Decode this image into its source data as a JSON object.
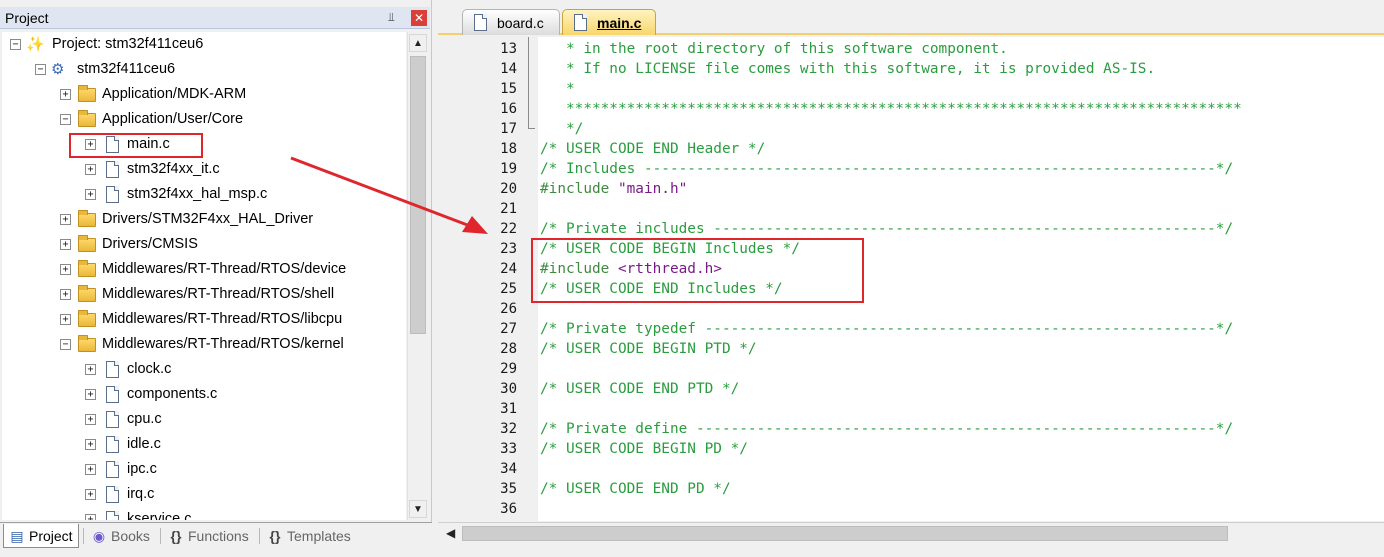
{
  "project_pane": {
    "title": "Project",
    "pin_glyph": "⫫",
    "close_glyph": "✕",
    "tree": [
      {
        "label": "Project: stm32f411ceu6",
        "kind": "project",
        "expander": "−",
        "indent": 0
      },
      {
        "label": "stm32f411ceu6",
        "kind": "target",
        "expander": "−",
        "indent": 1
      },
      {
        "label": "Application/MDK-ARM",
        "kind": "folder",
        "expander": "+",
        "indent": 2
      },
      {
        "label": "Application/User/Core",
        "kind": "folder-open",
        "expander": "−",
        "indent": 2
      },
      {
        "label": "main.c",
        "kind": "file",
        "expander": "+",
        "indent": 3
      },
      {
        "label": "stm32f4xx_it.c",
        "kind": "file",
        "expander": "+",
        "indent": 3
      },
      {
        "label": "stm32f4xx_hal_msp.c",
        "kind": "file",
        "expander": "+",
        "indent": 3
      },
      {
        "label": "Drivers/STM32F4xx_HAL_Driver",
        "kind": "folder",
        "expander": "+",
        "indent": 2
      },
      {
        "label": "Drivers/CMSIS",
        "kind": "folder",
        "expander": "+",
        "indent": 2
      },
      {
        "label": "Middlewares/RT-Thread/RTOS/device",
        "kind": "folder",
        "expander": "+",
        "indent": 2
      },
      {
        "label": "Middlewares/RT-Thread/RTOS/shell",
        "kind": "folder",
        "expander": "+",
        "indent": 2
      },
      {
        "label": "Middlewares/RT-Thread/RTOS/libcpu",
        "kind": "folder",
        "expander": "+",
        "indent": 2
      },
      {
        "label": "Middlewares/RT-Thread/RTOS/kernel",
        "kind": "folder-open",
        "expander": "−",
        "indent": 2
      },
      {
        "label": "clock.c",
        "kind": "file",
        "expander": "+",
        "indent": 3
      },
      {
        "label": "components.c",
        "kind": "file",
        "expander": "+",
        "indent": 3
      },
      {
        "label": "cpu.c",
        "kind": "file",
        "expander": "+",
        "indent": 3
      },
      {
        "label": "idle.c",
        "kind": "file",
        "expander": "+",
        "indent": 3
      },
      {
        "label": "ipc.c",
        "kind": "file",
        "expander": "+",
        "indent": 3
      },
      {
        "label": "irq.c",
        "kind": "file",
        "expander": "+",
        "indent": 3
      },
      {
        "label": "kservice.c",
        "kind": "file",
        "expander": "+",
        "indent": 3
      }
    ],
    "highlighted_item": "main.c",
    "bottom_tabs": [
      {
        "label": "Project",
        "icon": "▤",
        "active": true
      },
      {
        "label": "Books",
        "icon": "◉",
        "active": false
      },
      {
        "label": "Functions",
        "icon": "{}",
        "active": false
      },
      {
        "label": "Templates",
        "icon": "{}",
        "active": false
      }
    ]
  },
  "editor": {
    "tabs": [
      {
        "label": "board.c",
        "active": false
      },
      {
        "label": "main.c",
        "active": true
      }
    ],
    "lines": [
      {
        "n": "13",
        "text": "   * in the root directory of this software component.",
        "cls": "c-comment"
      },
      {
        "n": "14",
        "text": "   * If no LICENSE file comes with this software, it is provided AS-IS.",
        "cls": "c-comment"
      },
      {
        "n": "15",
        "text": "   *",
        "cls": "c-comment"
      },
      {
        "n": "16",
        "text": "   ******************************************************************************",
        "cls": "c-comment"
      },
      {
        "n": "17",
        "text": "   */",
        "cls": "c-comment"
      },
      {
        "n": "18",
        "text": "/* USER CODE END Header */",
        "cls": "c-comment"
      },
      {
        "n": "19",
        "text": "/* Includes ------------------------------------------------------------------*/",
        "cls": "c-comment"
      },
      {
        "n": "20",
        "pre": "#include ",
        "str": "\"main.h\"",
        "cls": "c-pre"
      },
      {
        "n": "21",
        "text": "",
        "cls": "c-comment"
      },
      {
        "n": "22",
        "text": "/* Private includes ----------------------------------------------------------*/",
        "cls": "c-comment"
      },
      {
        "n": "23",
        "text": "/* USER CODE BEGIN Includes */",
        "cls": "c-comment"
      },
      {
        "n": "24",
        "pre": "#include ",
        "str": "<rtthread.h>",
        "cls": "c-pre"
      },
      {
        "n": "25",
        "text": "/* USER CODE END Includes */",
        "cls": "c-comment"
      },
      {
        "n": "26",
        "text": "",
        "cls": "c-comment"
      },
      {
        "n": "27",
        "text": "/* Private typedef -----------------------------------------------------------*/",
        "cls": "c-comment"
      },
      {
        "n": "28",
        "text": "/* USER CODE BEGIN PTD */",
        "cls": "c-comment"
      },
      {
        "n": "29",
        "text": "",
        "cls": "c-comment"
      },
      {
        "n": "30",
        "text": "/* USER CODE END PTD */",
        "cls": "c-comment"
      },
      {
        "n": "31",
        "text": "",
        "cls": "c-comment"
      },
      {
        "n": "32",
        "text": "/* Private define ------------------------------------------------------------*/",
        "cls": "c-comment"
      },
      {
        "n": "33",
        "text": "/* USER CODE BEGIN PD */",
        "cls": "c-comment"
      },
      {
        "n": "34",
        "text": "",
        "cls": "c-comment"
      },
      {
        "n": "35",
        "text": "/* USER CODE END PD */",
        "cls": "c-comment"
      },
      {
        "n": "36",
        "text": "",
        "cls": "c-comment"
      }
    ]
  },
  "colors": {
    "annotation_red": "#e0262d",
    "comment_green": "#2a9d3f",
    "string_purple": "#7a1a8a",
    "active_tab_yellow": "#f7d66a"
  }
}
